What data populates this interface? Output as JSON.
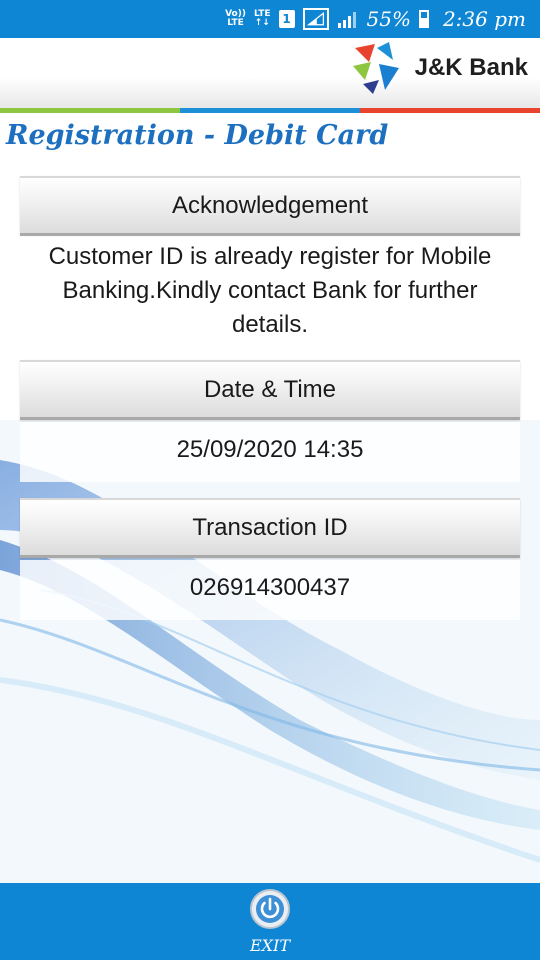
{
  "status_bar": {
    "volte": "Vo))\nLTE",
    "lte": "LTE",
    "sim": "1",
    "battery_percent": "55%",
    "time": "2:36 pm"
  },
  "header": {
    "bank_name": "J&K Bank",
    "stripe_colors": [
      "#8dc63f",
      "#1e90d8",
      "#e8432d"
    ]
  },
  "page_title": "Registration - Debit Card",
  "acknowledgement": {
    "heading": "Acknowledgement",
    "message": "Customer ID is already register for Mobile Banking.Kindly contact Bank for further details."
  },
  "date_time": {
    "heading": "Date & Time",
    "value": "25/09/2020 14:35"
  },
  "transaction": {
    "heading": "Transaction ID",
    "value": "026914300437"
  },
  "footer": {
    "exit_label": "EXIT"
  },
  "colors": {
    "primary_blue": "#0e86d4",
    "title_blue": "#1d6fbf"
  }
}
